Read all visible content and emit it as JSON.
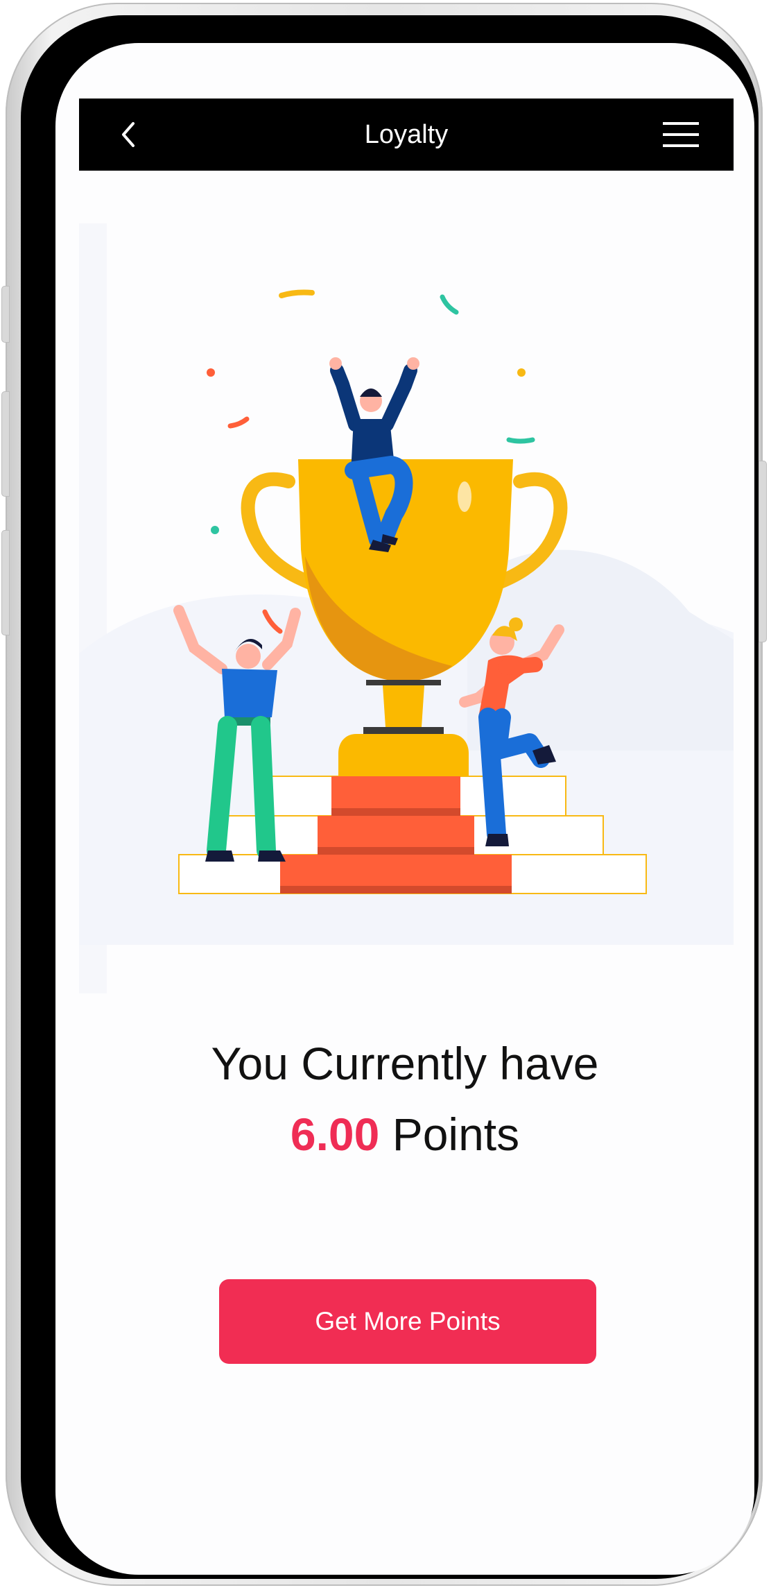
{
  "header": {
    "title": "Loyalty",
    "back_icon": "chevron-left-icon",
    "menu_icon": "hamburger-menu-icon"
  },
  "illustration": {
    "description_icon": "trophy-celebration-illustration"
  },
  "points": {
    "prefix": "You Currently have",
    "value": "6.00",
    "unit": "Points"
  },
  "cta": {
    "label": "Get More Points"
  },
  "colors": {
    "accent": "#f12d53",
    "header_bg": "#000000",
    "trophy": "#fbb900",
    "podium": "#ff5f39"
  }
}
